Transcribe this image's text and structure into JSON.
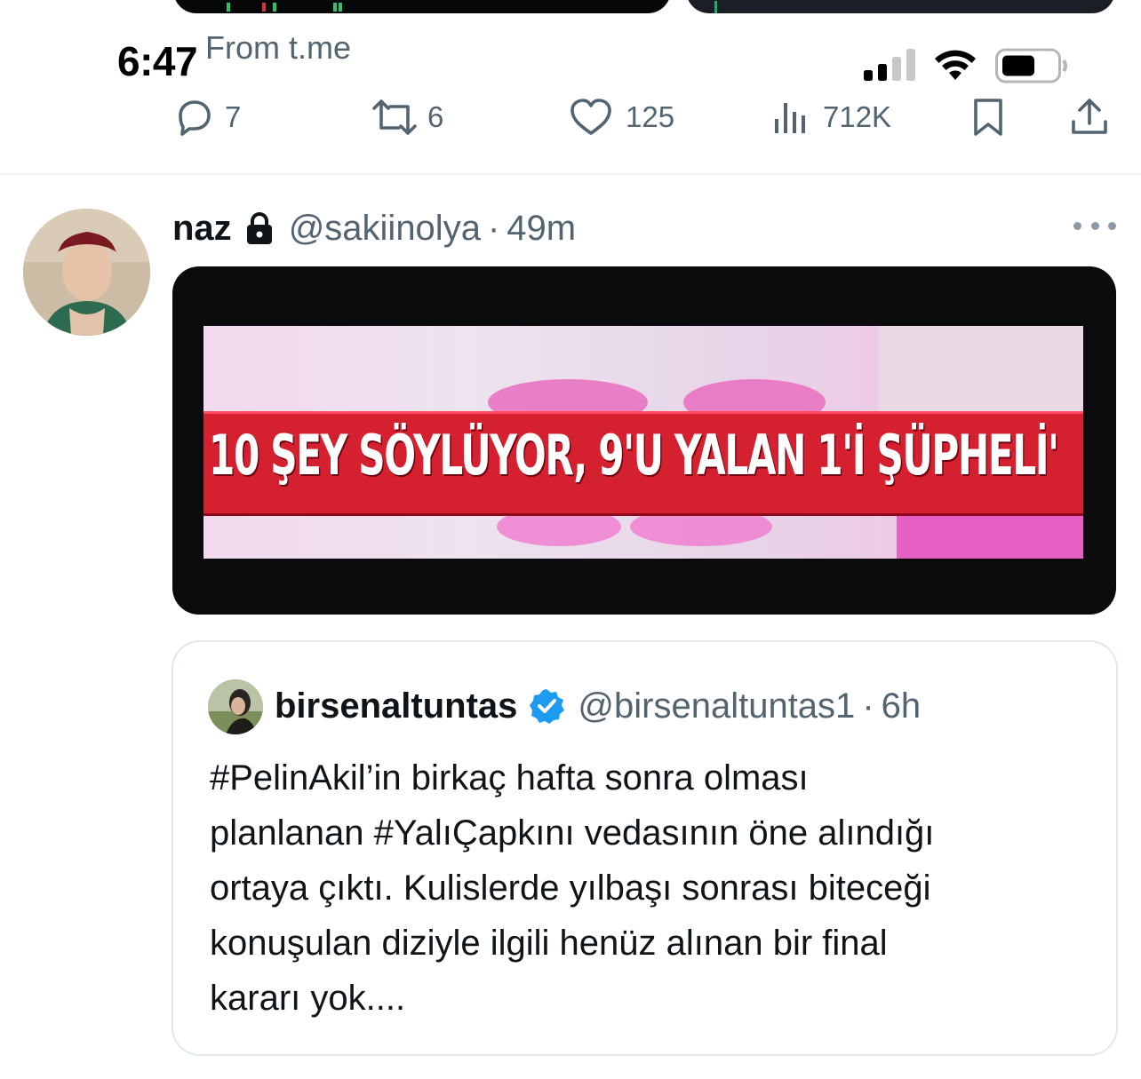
{
  "status_bar": {
    "time": "6:47"
  },
  "source_label": "From t.me",
  "prev_tweet_actions": {
    "replies": "7",
    "reposts": "6",
    "likes": "125",
    "views": "712K"
  },
  "tweet": {
    "display_name": "naz",
    "handle": "@sakiinolya",
    "separator": "·",
    "time_ago": "49m",
    "media_caption": "10 ŞEY SÖYLÜYOR, 9'U YALAN 1'İ ŞÜPHELİ'",
    "quoted": {
      "display_name": "birsenaltuntas",
      "handle": "@birsenaltuntas1",
      "separator": "·",
      "time_ago": "6h",
      "text": "#PelinAkil’in birkaç hafta sonra olması\nplanlanan #YalıÇapkını vedasının öne alındığı\nortaya çıktı. Kulislerde yılbaşı sonrası biteceği\nkonuşulan diziyle ilgili henüz alınan bir final\nkararı yok...."
    }
  },
  "icons": {
    "reply": "reply-icon",
    "repost": "repost-icon",
    "like": "heart-icon",
    "views": "views-icon",
    "bookmark": "bookmark-icon",
    "share": "share-icon",
    "lock": "lock-icon",
    "verified": "verified-badge-icon",
    "more": "more-icon"
  },
  "colors": {
    "muted": "#536471",
    "verified": "#1d9bf0",
    "ticker": "#d4202f"
  }
}
